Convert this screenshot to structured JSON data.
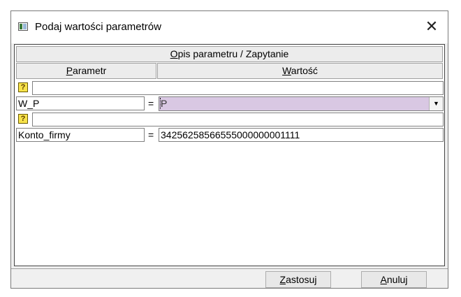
{
  "window": {
    "title": "Podaj wartości parametrów",
    "close_symbol": "✕"
  },
  "grid": {
    "header_main": {
      "accel": "O",
      "rest": "pis parametru / Zapytanie"
    },
    "col_param": {
      "accel": "P",
      "rest": "arametr"
    },
    "col_value": {
      "accel": "W",
      "rest": "artość"
    },
    "rows": [
      {
        "type": "query",
        "icon": "question-icon",
        "icon_glyph": "?",
        "text": ""
      },
      {
        "type": "param",
        "name": "W_P",
        "eq": "=",
        "value": "P",
        "editor": "dropdown"
      },
      {
        "type": "query",
        "icon": "question-icon",
        "icon_glyph": "?",
        "text": ""
      },
      {
        "type": "param",
        "name": "Konto_firmy",
        "eq": "=",
        "value": "34256258566555000000001111"
      }
    ],
    "dropdown_arrow": "▼"
  },
  "buttons": {
    "apply": {
      "accel": "Z",
      "rest": "astosuj"
    },
    "cancel": {
      "accel": "A",
      "rest": "nuluj"
    }
  },
  "colors": {
    "selected_value_bg": "#d9c8e3",
    "query_icon": "#f7e34a"
  }
}
